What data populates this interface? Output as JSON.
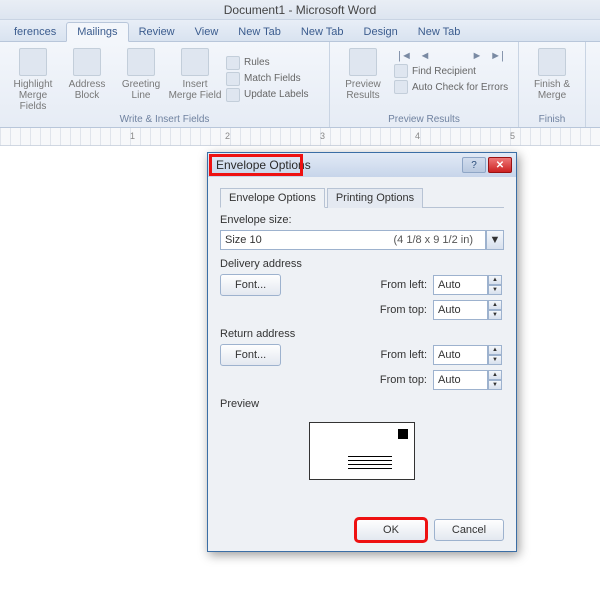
{
  "titlebar": "Document1  -  Microsoft Word",
  "tabs": {
    "t0": "ferences",
    "t1": "Mailings",
    "t2": "Review",
    "t3": "View",
    "t4": "New Tab",
    "t5": "New Tab",
    "t6": "Design",
    "t7": "New Tab"
  },
  "ribbon": {
    "grp1_label": "Write & Insert Fields",
    "grp2_label": "Preview Results",
    "grp3_label": "Finish",
    "highlight": "Highlight Merge Fields",
    "address": "Address Block",
    "greeting": "Greeting Line",
    "insertmf": "Insert Merge Field",
    "rules": "Rules",
    "match": "Match Fields",
    "update": "Update Labels",
    "preview": "Preview Results",
    "findrec": "Find Recipient",
    "autocheck": "Auto Check for Errors",
    "finish": "Finish & Merge"
  },
  "ruler": {
    "n1": "1",
    "n2": "2",
    "n3": "3",
    "n4": "4",
    "n5": "5"
  },
  "dialog": {
    "title": "Envelope Options",
    "tab1": "Envelope Options",
    "tab2": "Printing Options",
    "env_size_label": "Envelope size:",
    "env_size_value": "Size 10",
    "env_size_dim": "(4 1/8 x 9 1/2 in)",
    "delivery_label": "Delivery address",
    "return_label": "Return address",
    "font_btn": "Font...",
    "font_btn2": "Font...",
    "from_left": "From left:",
    "from_top": "From top:",
    "auto": "Auto",
    "preview_label": "Preview",
    "ok": "OK",
    "cancel": "Cancel"
  }
}
